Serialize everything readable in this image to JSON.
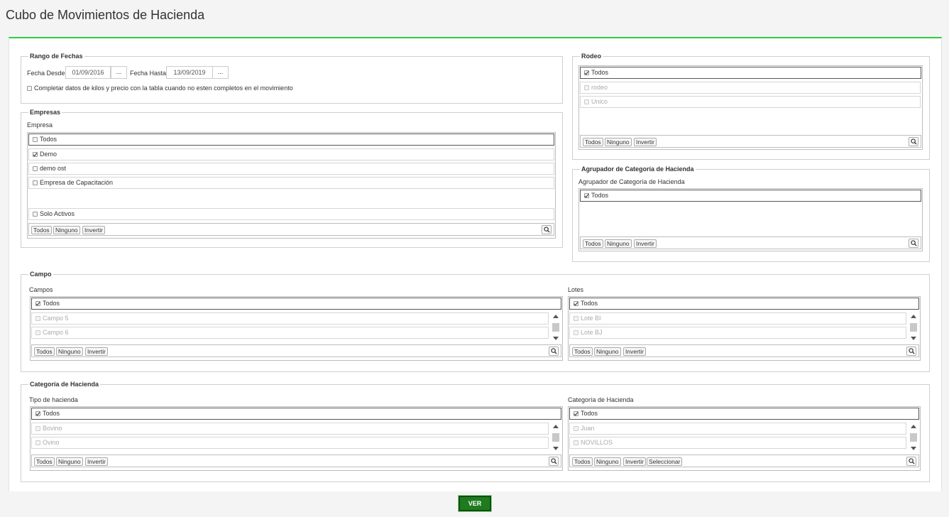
{
  "title": "Cubo de Movimientos de Hacienda",
  "rango": {
    "legend": "Rango de Fechas",
    "desde_label": "Fecha Desde",
    "desde_value": "01/09/2016",
    "hasta_label": "Fecha Hasta",
    "hasta_value": "13/09/2019",
    "dots": "...",
    "completar_label": "Completar datos de kilos y precio con la tabla cuando no esten completos en el movimiento"
  },
  "empresas": {
    "legend": "Empresas",
    "label": "Empresa",
    "all": "Todos",
    "items": [
      "Demo",
      "demo ost",
      "Empresa de Capacitación"
    ],
    "solo_activos": "Solo Activos",
    "btn_todos": "Todos",
    "btn_ninguno": "Ninguno",
    "btn_invertir": "Invertir"
  },
  "rodeo": {
    "legend": "Rodeo",
    "all": "Todos",
    "items": [
      "rodeo",
      "Unico"
    ],
    "btn_todos": "Todos",
    "btn_ninguno": "Ninguno",
    "btn_invertir": "Invertir"
  },
  "agrupador": {
    "legend": "Agrupador de Categoría de Hacienda",
    "label": "Agrupador de Categoría de Hacienda",
    "all": "Todos",
    "btn_todos": "Todos",
    "btn_ninguno": "Ninguno",
    "btn_invertir": "Invertir"
  },
  "campo": {
    "legend": "Campo",
    "campos_label": "Campos",
    "campos_all": "Todos",
    "campos_items": [
      "Campo 5",
      "Campo 6"
    ],
    "lotes_label": "Lotes",
    "lotes_all": "Todos",
    "lotes_items": [
      "Lote BI",
      "Lote BJ"
    ],
    "btn_todos": "Todos",
    "btn_ninguno": "Ninguno",
    "btn_invertir": "Invertir"
  },
  "categoria": {
    "legend": "Categoría de Hacienda",
    "tipo_label": "Tipo de hacienda",
    "tipo_all": "Todos",
    "tipo_items": [
      "Bovino",
      "Ovino"
    ],
    "cat_label": "Categoría de Hacienda",
    "cat_all": "Todos",
    "cat_items": [
      "Juan",
      "NOVILLOS"
    ],
    "btn_todos": "Todos",
    "btn_ninguno": "Ninguno",
    "btn_invertir": "Invertir",
    "btn_seleccionar": "Seleccionar"
  },
  "ver_label": "VER"
}
